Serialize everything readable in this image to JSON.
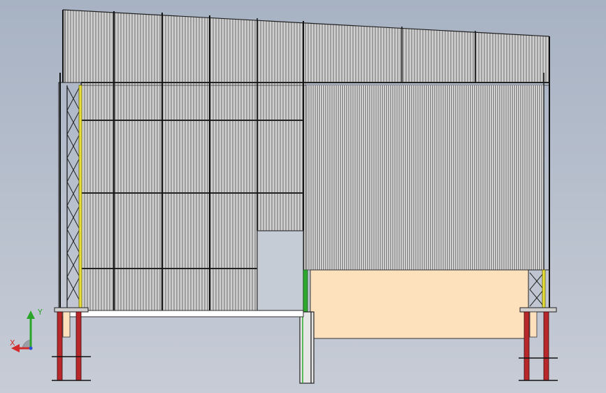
{
  "viewport": {
    "background_top": "#a7b2c3",
    "background_bottom": "#c7ccd6"
  },
  "model": {
    "description_icon": "steel-frame-building-elevation",
    "cladding_color": "#f2f2f2",
    "rib_color": "#3a3a3a",
    "column_highlight_color": "#e8e03a",
    "base_column_color": "#b8282a",
    "panel_color": "#fde0bc",
    "door_color": "#c6ccd5",
    "green_member_color": "#2fa82f"
  },
  "triad": {
    "x_label": "X",
    "y_label": "Y",
    "x_color": "#d22a2a",
    "y_color": "#2aa52a",
    "z_color": "#2a4fd2"
  }
}
